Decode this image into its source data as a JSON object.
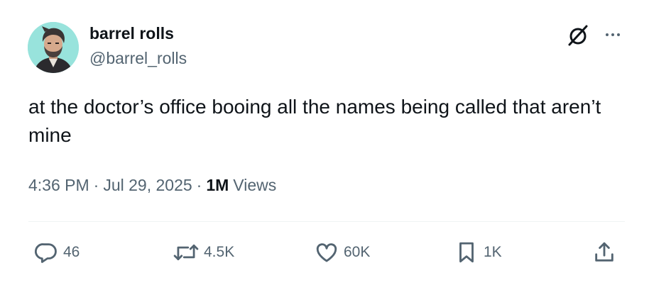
{
  "author": {
    "display_name": "barrel rolls",
    "handle": "@barrel_rolls"
  },
  "tweet": {
    "text": "at the doctor’s office booing all the names being called that aren’t mine"
  },
  "meta": {
    "time": "4:36 PM",
    "separator": "·",
    "date": "Jul 29, 2025",
    "views_count": "1M",
    "views_label": "Views"
  },
  "actions": {
    "replies": "46",
    "reposts": "4.5K",
    "likes": "60K",
    "bookmarks": "1K"
  },
  "icons": {
    "grok": "grok-icon",
    "more": "more-icon",
    "reply": "reply-icon",
    "repost": "repost-icon",
    "like": "heart-icon",
    "bookmark": "bookmark-icon",
    "share": "share-icon"
  },
  "colors": {
    "text_primary": "#0f1419",
    "text_secondary": "#536471",
    "divider": "#eff3f4",
    "avatar_background": "#98e3dc"
  }
}
